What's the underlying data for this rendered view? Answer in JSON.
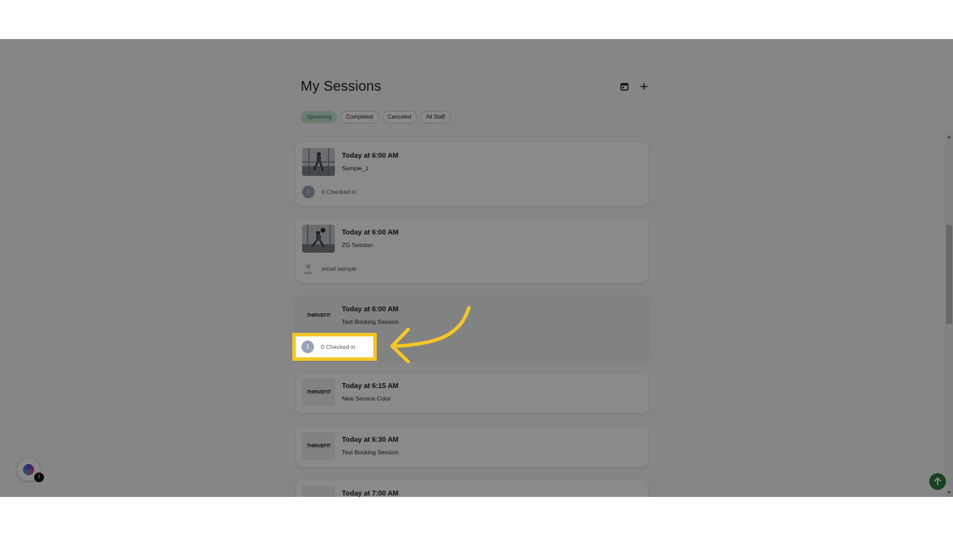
{
  "header": {
    "title": "My Sessions",
    "calendar_icon": "calendar-icon",
    "add_icon": "plus-icon"
  },
  "tabs": [
    {
      "label": "Upcoming",
      "active": true
    },
    {
      "label": "Completed",
      "active": false
    },
    {
      "label": "Canceled",
      "active": false
    },
    {
      "label": "All Staff",
      "active": false
    }
  ],
  "sessions": [
    {
      "time": "Today at 6:00 AM",
      "name": "Sample_1",
      "thumb": "photo",
      "footer_badge": "1",
      "footer_text": "0 Checked in"
    },
    {
      "time": "Today at 6:00 AM",
      "name": "ZG Session",
      "thumb": "photo",
      "footer_icon": "user-icon",
      "footer_text": "email sample"
    },
    {
      "time": "Today at 6:00 AM",
      "name": "Test Booking Session",
      "thumb": "logo",
      "footer_badge": "1",
      "footer_text": "0 Checked in"
    },
    {
      "time": "Today at 6:15 AM",
      "name": "New Service Color",
      "thumb": "logo"
    },
    {
      "time": "Today at 6:30 AM",
      "name": "Test Booking Session",
      "thumb": "logo"
    },
    {
      "time": "Today at 7:00 AM",
      "name": "",
      "thumb": "logo"
    }
  ],
  "logo_text": "THRIVEFIT",
  "widget": {
    "badge_count": "1"
  },
  "colors": {
    "accent_green": "#2f7d3b",
    "highlight_yellow": "#f6c627",
    "active_tab_bg": "#c9e6cf",
    "badge_gray": "#9aa3b6"
  }
}
